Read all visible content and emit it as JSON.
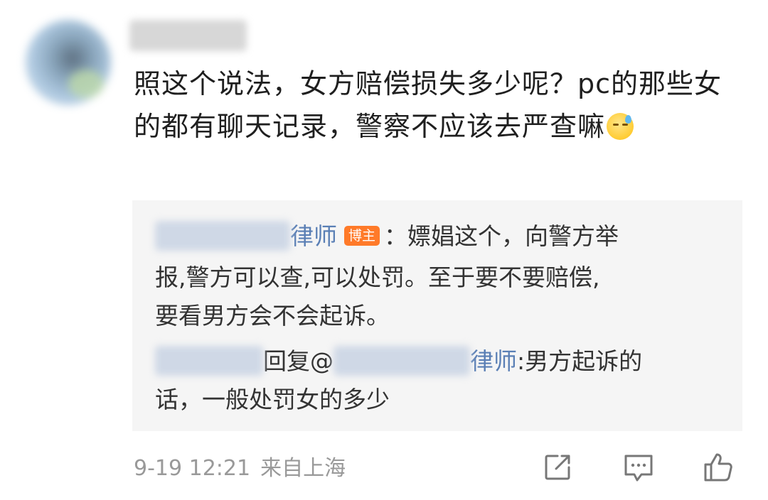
{
  "comment": {
    "text": "照这个说法，女方赔偿损失多少呢？pc的那些女的都有聊天记录，警察不应该去严查嘛",
    "emoji": "sweat-emoji"
  },
  "replies": [
    {
      "author_suffix": "律师",
      "badge": "博主",
      "line1": "：嫖娼这个，向警方举",
      "line2": "报,警方可以查,可以处罚。至于要不要赔偿,",
      "line3": "要看男方会不会起诉。"
    },
    {
      "reply_word": "回复@",
      "target_suffix": "律师",
      "line1_tail": ":男方起诉的",
      "line2": "话，一般处罚女的多少"
    }
  ],
  "footer": {
    "time": "9-19 12:21",
    "location": "来自上海"
  },
  "icons": {
    "share": "share-icon",
    "comment": "comment-icon",
    "like": "thumbs-up-icon"
  },
  "colors": {
    "link_blue": "#5a7fb5",
    "badge_orange": "#ff7a29",
    "meta_gray": "#999999"
  }
}
